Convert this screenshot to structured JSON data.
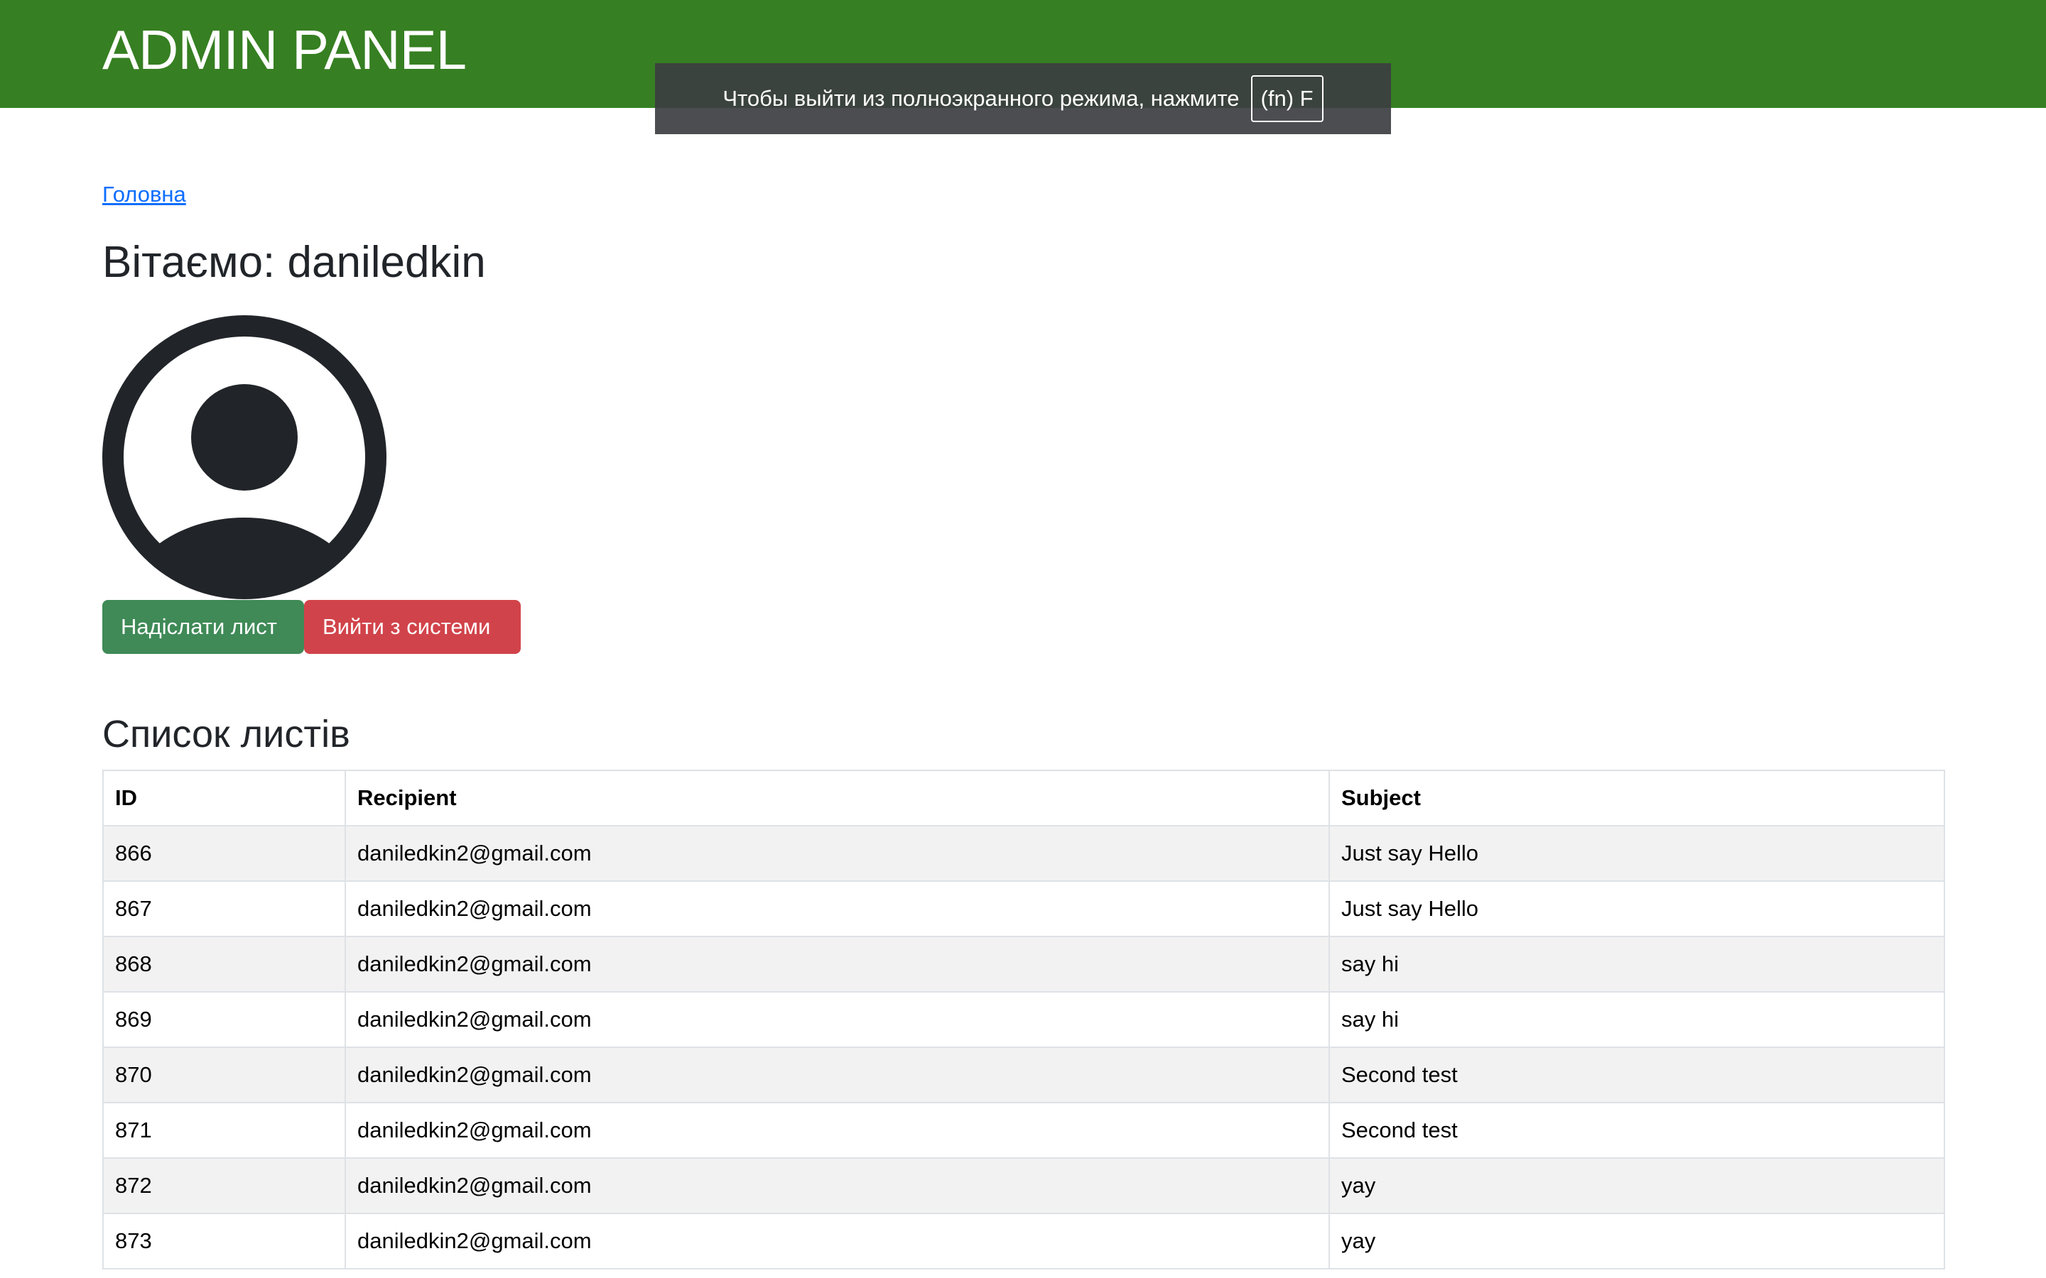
{
  "header": {
    "title": "ADMIN PANEL",
    "background": "#367f22"
  },
  "fullscreen_notice": {
    "text": "Чтобы выйти из полноэкранного режима, нажмите",
    "key": "(fn) F"
  },
  "breadcrumb": {
    "home_label": "Головна"
  },
  "welcome": {
    "text": "Вітаємо: daniledkin"
  },
  "avatar": {
    "icon": "user-circle-icon"
  },
  "actions": {
    "send_label": "Надіслати лист",
    "send_color": "#3f8a57",
    "logout_label": "Вийти з системи",
    "logout_color": "#d1434a"
  },
  "mails": {
    "title": "Список листів",
    "columns": [
      "ID",
      "Recipient",
      "Subject"
    ],
    "rows": [
      [
        "866",
        "daniledkin2@gmail.com",
        "Just say Hello"
      ],
      [
        "867",
        "daniledkin2@gmail.com",
        "Just say Hello"
      ],
      [
        "868",
        "daniledkin2@gmail.com",
        "say hi"
      ],
      [
        "869",
        "daniledkin2@gmail.com",
        "say hi"
      ],
      [
        "870",
        "daniledkin2@gmail.com",
        "Second test"
      ],
      [
        "871",
        "daniledkin2@gmail.com",
        "Second test"
      ],
      [
        "872",
        "daniledkin2@gmail.com",
        "yay"
      ],
      [
        "873",
        "daniledkin2@gmail.com",
        "yay"
      ]
    ]
  }
}
